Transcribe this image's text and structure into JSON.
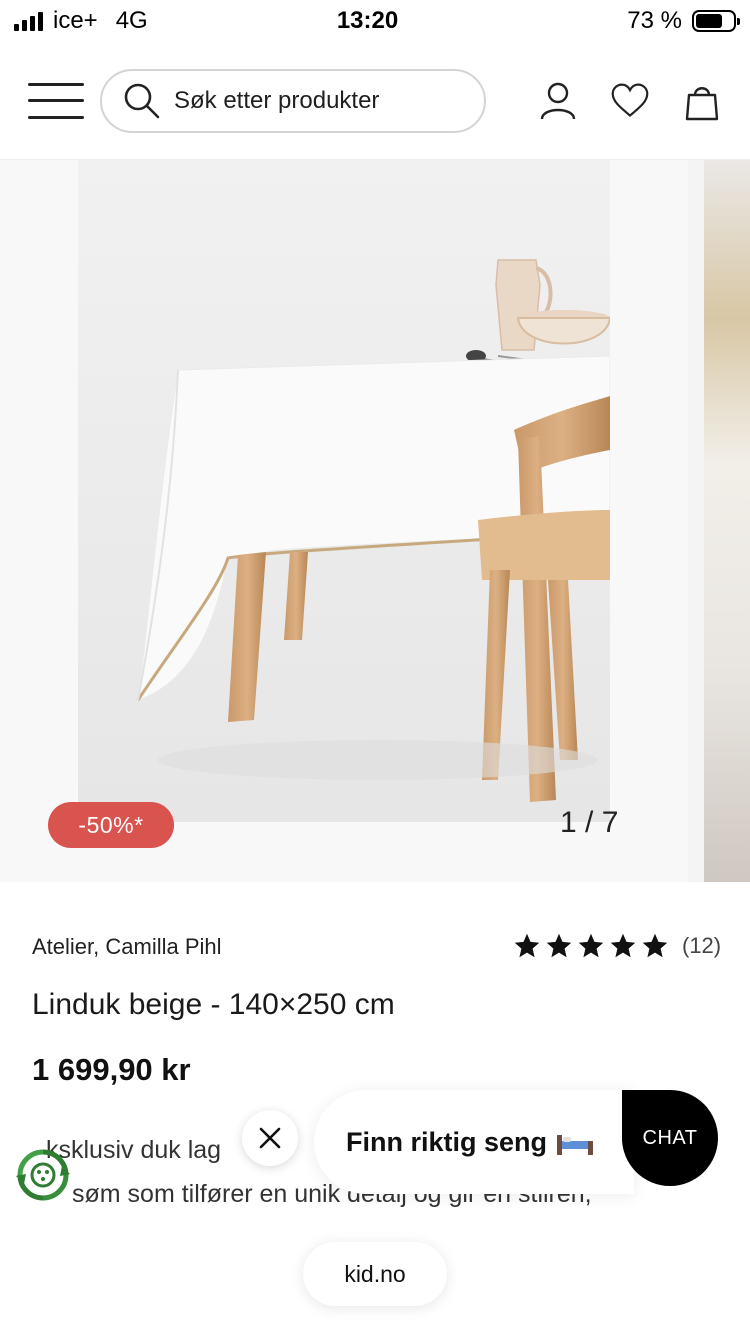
{
  "status_bar": {
    "carrier": "ice+",
    "network": "4G",
    "time": "13:20",
    "battery_text": "73 %",
    "battery_level": 0.73
  },
  "header": {
    "search_placeholder": "Søk etter produkter",
    "icons": [
      "menu-icon",
      "search-icon",
      "user-icon",
      "heart-icon",
      "bag-icon"
    ]
  },
  "gallery": {
    "discount": "-50%*",
    "counter": "1 / 7",
    "discount_color": "#d9534f"
  },
  "product": {
    "brand": "Atelier, Camilla Pihl",
    "rating_count": "(12)",
    "rating_stars": 5,
    "title": "Linduk beige - 140×250 cm",
    "price": "1 699,90 kr",
    "description_line1": "ksklusiv duk lag",
    "description_line2": "søm som tilfører en unik detalj og gir en stilren,"
  },
  "widgets": {
    "promo_text": "Finn riktig seng",
    "chat_label": "CHAT",
    "url": "kid.no"
  }
}
